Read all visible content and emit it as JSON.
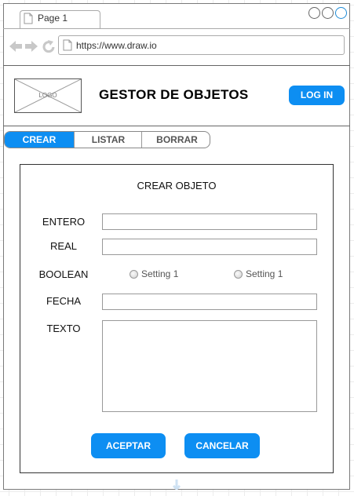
{
  "browser": {
    "tab_title": "Page 1",
    "url": "https://www.draw.io"
  },
  "header": {
    "logo_text": "LOGO",
    "title": "GESTOR DE OBJETOS",
    "login_label": "LOG IN"
  },
  "tabs": [
    {
      "label": "CREAR",
      "active": true
    },
    {
      "label": "LISTAR",
      "active": false
    },
    {
      "label": "BORRAR",
      "active": false
    }
  ],
  "form": {
    "title": "CREAR OBJETO",
    "labels": {
      "entero": "ENTERO",
      "real": "REAL",
      "boolean": "BOOLEAN",
      "fecha": "FECHA",
      "texto": "TEXTO"
    },
    "values": {
      "entero": "",
      "real": "",
      "fecha": "",
      "texto": ""
    },
    "boolean_options": [
      "Setting 1",
      "Setting 1"
    ],
    "accept_label": "ACEPTAR",
    "cancel_label": "CANCELAR"
  },
  "colors": {
    "accent": "#0d8ef2",
    "window_circle_active": "#1f8bd6"
  }
}
